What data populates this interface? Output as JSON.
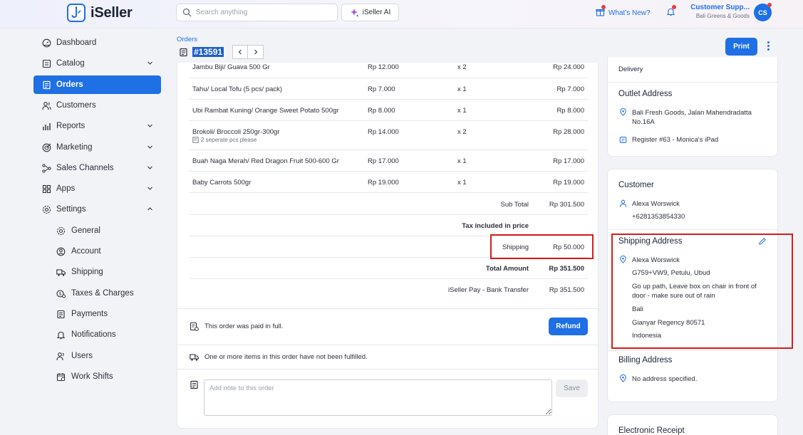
{
  "brand": {
    "name": "iSeller"
  },
  "topbar": {
    "search_placeholder": "Search anything",
    "ai_label": "iSeller AI",
    "whats_new": "What's New?",
    "user_name": "Customer Supp...",
    "user_store": "Bali Greens & Goods",
    "avatar_initials": "CS"
  },
  "sidebar": {
    "items": [
      {
        "label": "Dashboard",
        "icon": "dashboard-icon"
      },
      {
        "label": "Catalog",
        "icon": "catalog-icon"
      },
      {
        "label": "Orders",
        "icon": "orders-icon"
      },
      {
        "label": "Customers",
        "icon": "customers-icon"
      },
      {
        "label": "Reports",
        "icon": "reports-icon"
      },
      {
        "label": "Marketing",
        "icon": "marketing-icon"
      },
      {
        "label": "Sales Channels",
        "icon": "sales-channels-icon"
      },
      {
        "label": "Apps",
        "icon": "apps-icon"
      },
      {
        "label": "Settings",
        "icon": "settings-icon"
      }
    ],
    "settings_items": [
      {
        "label": "General",
        "icon": "general-icon"
      },
      {
        "label": "Account",
        "icon": "account-icon"
      },
      {
        "label": "Shipping",
        "icon": "shipping-icon"
      },
      {
        "label": "Taxes & Charges",
        "icon": "taxes-icon"
      },
      {
        "label": "Payments",
        "icon": "payments-icon"
      },
      {
        "label": "Notifications",
        "icon": "notifications-icon"
      },
      {
        "label": "Users",
        "icon": "users-icon"
      },
      {
        "label": "Work Shifts",
        "icon": "work-shifts-icon"
      }
    ]
  },
  "header": {
    "breadcrumb": "Orders",
    "order_id": "#13591",
    "print_label": "Print"
  },
  "order": {
    "items": [
      {
        "name": "Jambu Biji/ Guava 500 Gr",
        "price": "Rp 12.000",
        "qty": "x 2",
        "total": "Rp 24.000"
      },
      {
        "name": "Tahu/ Local Tofu (5 pcs/ pack)",
        "price": "Rp 7.000",
        "qty": "x 1",
        "total": "Rp 7.000"
      },
      {
        "name": "Ubi Rambat Kuning/ Orange Sweet Potato 500gr",
        "price": "Rp 8.000",
        "qty": "x 1",
        "total": "Rp 8.000"
      },
      {
        "name": "Brokoli/ Broccoli 250gr-300gr",
        "price": "Rp 14.000",
        "qty": "x 2",
        "total": "Rp 28.000",
        "note": "2 seperate pcs please"
      },
      {
        "name": "Buah Naga Merah/ Red Dragon Fruit 500-600 Gr",
        "price": "Rp 17.000",
        "qty": "x 1",
        "total": "Rp 17.000"
      },
      {
        "name": "Baby Carrots 500gr",
        "price": "Rp 19.000",
        "qty": "x 1",
        "total": "Rp 19.000"
      }
    ],
    "subtotal_label": "Sub Total",
    "subtotal": "Rp 301.500",
    "tax_label": "Tax included in price",
    "shipping_label": "Shipping",
    "shipping": "Rp 50.000",
    "total_label": "Total Amount",
    "total": "Rp 351.500",
    "payment_label": "iSeller Pay - Bank Transfer",
    "payment": "Rp 351.500",
    "paid_text": "This order was paid in full.",
    "refund_label": "Refund",
    "unfulfilled_text": "One or more items in this order have not been fulfilled.",
    "note_placeholder": "Add note to this order",
    "save_label": "Save"
  },
  "right": {
    "delivery": "Delivery",
    "outlet_title": "Outlet Address",
    "outlet_address": "Bali Fresh Goods, Jalan Mahendradatta No.16A",
    "outlet_register": "Register #63 - Monica's iPad",
    "customer_title": "Customer",
    "customer_name": "Alexa Worswick",
    "customer_phone": "+6281353854330",
    "shipping_title": "Shipping Address",
    "ship_name": "Alexa Worswick",
    "ship_line1": "G759+VW9, Petulu, Ubud",
    "ship_note": "Go up path, Leave box on chair in front of door - make sure out of rain",
    "ship_region": "Bali",
    "ship_city": "Gianyar Regency 80571",
    "ship_country": "Indonesia",
    "billing_title": "Billing Address",
    "billing_text": "No address specified.",
    "receipt_title": "Electronic Receipt"
  },
  "colors": {
    "accent": "#1f6fe5",
    "highlight": "#d91b1b",
    "notification": "#ef3b3b"
  }
}
